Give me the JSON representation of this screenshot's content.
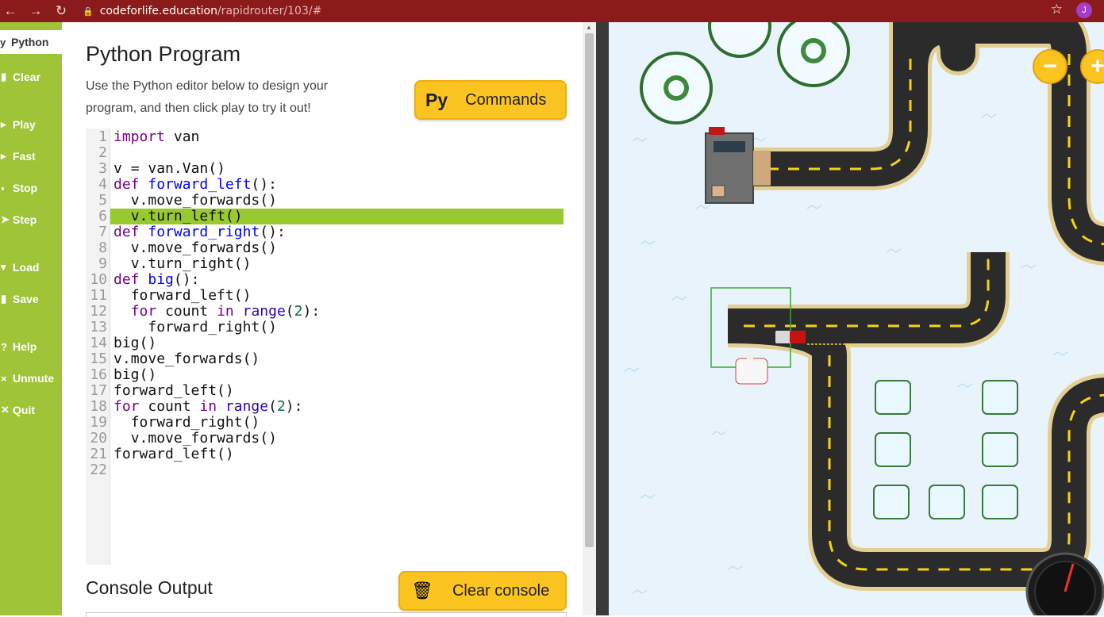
{
  "browser": {
    "url_host": "codeforlife.education",
    "url_path": "/rapidrouter/103/#",
    "avatar_letter": "J"
  },
  "sidebar": {
    "python_tab": "Python",
    "items": [
      {
        "icon": "clear-icon",
        "glyph": "▮",
        "label": "Clear"
      },
      {
        "icon": "play-icon",
        "glyph": "▸",
        "label": "Play"
      },
      {
        "icon": "fast-icon",
        "glyph": "▸",
        "label": "Fast"
      },
      {
        "icon": "stop-icon",
        "glyph": "▪",
        "label": "Stop"
      },
      {
        "icon": "step-icon",
        "glyph": "➤",
        "label": "Step"
      },
      {
        "icon": "load-icon",
        "glyph": "▾",
        "label": "Load"
      },
      {
        "icon": "save-icon",
        "glyph": "▮",
        "label": "Save"
      },
      {
        "icon": "help-icon",
        "glyph": "?",
        "label": "Help"
      },
      {
        "icon": "mute-icon",
        "glyph": "×",
        "label": "Unmute"
      },
      {
        "icon": "quit-icon",
        "glyph": "✕",
        "label": "Quit"
      }
    ]
  },
  "main": {
    "title": "Python Program",
    "description": "Use the Python editor below to design your program, and then click play to try it out!",
    "commands_button": {
      "badge": "Py",
      "label": "Commands"
    },
    "console_title": "Console Output",
    "clear_console_label": "Clear console"
  },
  "editor": {
    "highlighted_line": 6,
    "lines": [
      "import van",
      "",
      "v = van.Van()",
      "def forward_left():",
      "  v.move_forwards()",
      "  v.turn_left()",
      "def forward_right():",
      "  v.move_forwards()",
      "  v.turn_right()",
      "def big():",
      "  forward_left()",
      "  for count in range(2):",
      "    forward_right()",
      "big()",
      "v.move_forwards()",
      "big()",
      "forward_left()",
      "for count in range(2):",
      "  forward_right()",
      "  v.move_forwards()",
      "forward_left()",
      ""
    ]
  },
  "colors": {
    "sidebar_green": "#a0c437",
    "highlight_green": "#98c931",
    "button_yellow": "#fcc420",
    "browser_bar": "#8b1a1a",
    "road": "#2b2b2b",
    "road_edge": "#e3cf94",
    "snow": "#e8f3fc"
  },
  "map": {
    "zoom_out": "−",
    "zoom_in": "+"
  }
}
